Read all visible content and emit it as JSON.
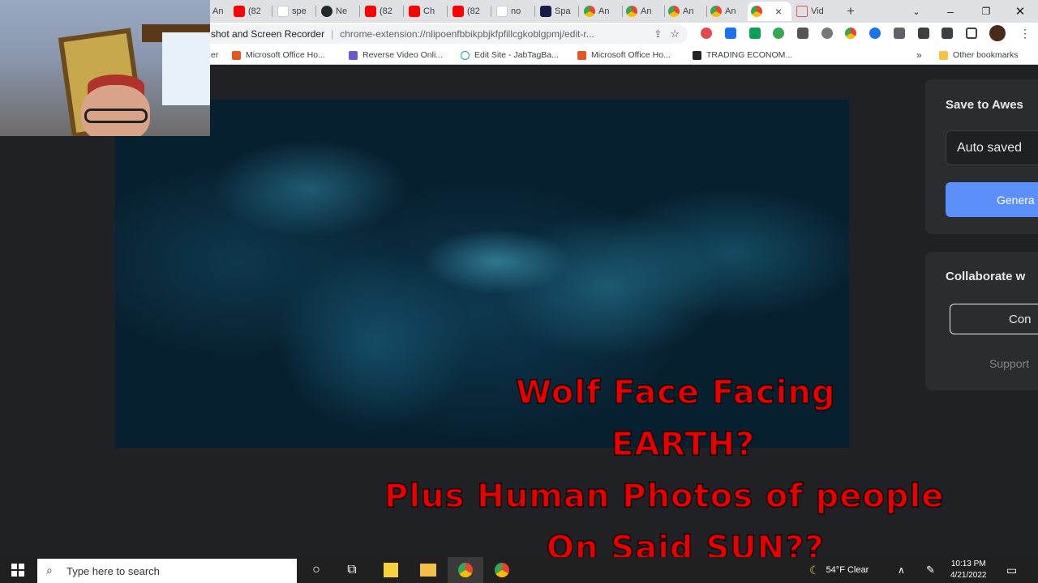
{
  "browser": {
    "tabs": [
      {
        "label": "An",
        "icon": "chrome-icon"
      },
      {
        "label": "(82",
        "icon": "youtube-icon"
      },
      {
        "label": "spe",
        "icon": "google-icon"
      },
      {
        "label": "Ne",
        "icon": "github-icon"
      },
      {
        "label": "(82",
        "icon": "youtube-icon"
      },
      {
        "label": "Ch",
        "icon": "youtube-icon"
      },
      {
        "label": "(82",
        "icon": "youtube-icon"
      },
      {
        "label": "no",
        "icon": "google-icon"
      },
      {
        "label": "Spa",
        "icon": "space-icon"
      },
      {
        "label": "An",
        "icon": "chrome-icon"
      },
      {
        "label": "An",
        "icon": "chrome-icon"
      },
      {
        "label": "An",
        "icon": "chrome-icon"
      },
      {
        "label": "An",
        "icon": "chrome-icon"
      },
      {
        "label": "",
        "icon": "chrome-icon"
      },
      {
        "label": "Vid",
        "icon": "video-icon"
      }
    ],
    "active_tab_close": "×",
    "new_tab": "+",
    "omnibox": {
      "site": "shot and Screen Recorder",
      "separator": "|",
      "url": "chrome-extension://nlipoenfbbikpbjkfpfillcgkoblgpmj/edit-r..."
    },
    "bookmarks": [
      {
        "label": "er"
      },
      {
        "label": "Microsoft Office Ho..."
      },
      {
        "label": "Reverse Video Onli..."
      },
      {
        "label": "Edit Site - JabTagBa..."
      },
      {
        "label": "Microsoft Office Ho..."
      },
      {
        "label": "TRADING ECONOM..."
      }
    ],
    "bookmarks_more": "»",
    "other_bookmarks": "Other bookmarks"
  },
  "sidebar": {
    "save_title": "Save to Awes",
    "auto_saved": "Auto saved",
    "generate_button": "Genera",
    "collaborate_title": "Collaborate w",
    "connect_button": "Con",
    "support_text": "Support"
  },
  "overlay_caption": {
    "line1": "Wolf Face Facing",
    "line2": "EARTH?",
    "line3": "Plus Human Photos of people",
    "line4": "On Said SUN??"
  },
  "taskbar": {
    "search_placeholder": "Type here to search",
    "weather": "54°F  Clear",
    "time": "10:13 PM",
    "date": "4/21/2022"
  },
  "colors": {
    "accent": "#5b8ff9",
    "overlay_text": "#e60000",
    "solar_video": "#072030"
  }
}
